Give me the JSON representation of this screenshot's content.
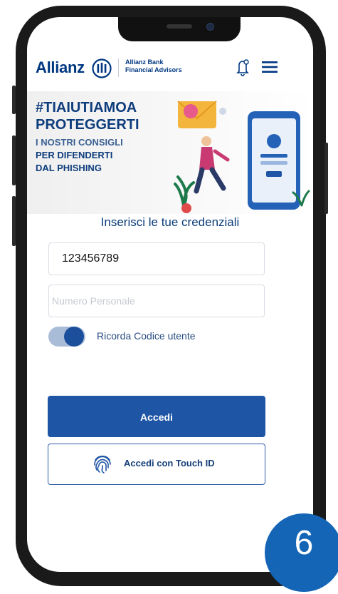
{
  "header": {
    "brand": "Allianz",
    "bank_line1": "Allianz Bank",
    "bank_line2": "Financial Advisors"
  },
  "banner": {
    "line1": "#TIAIUTIAMOA",
    "line2": "PROTEGGERTI",
    "line3": "I NOSTRI CONSIGLI",
    "line4": "PER DIFENDERTI",
    "line5": "DAL PHISHING"
  },
  "login": {
    "title": "Inserisci le tue credenziali",
    "user_code_value": "123456789",
    "pin_placeholder": "Numero Personale",
    "remember_label": "Ricorda Codice utente",
    "remember_on": true,
    "login_button": "Accedi",
    "touch_id_button": "Accedi con Touch ID"
  },
  "step_badge": "6",
  "colors": {
    "brand_blue": "#003781",
    "primary_button": "#1e55a5",
    "badge": "#1565b7"
  }
}
